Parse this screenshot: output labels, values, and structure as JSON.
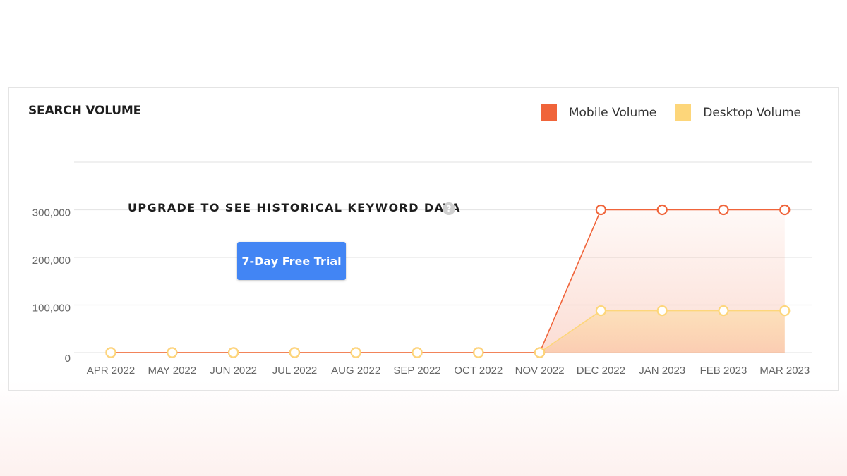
{
  "card": {
    "title": "SEARCH VOLUME"
  },
  "upgrade": {
    "message": "UPGRADE TO SEE HISTORICAL KEYWORD DATA",
    "help_glyph": "?",
    "button_label": "7-Day Free Trial"
  },
  "colors": {
    "mobile": "#f0643a",
    "desktop": "#fdd67a",
    "button": "#4285f4",
    "grid": "#e6e6e6"
  },
  "icons": {
    "help": "question-circle-icon"
  },
  "chart_data": {
    "type": "area",
    "title": "SEARCH VOLUME",
    "categories": [
      "APR 2022",
      "MAY 2022",
      "JUN 2022",
      "JUL 2022",
      "AUG 2022",
      "SEP 2022",
      "OCT 2022",
      "NOV 2022",
      "DEC 2022",
      "JAN 2023",
      "FEB 2023",
      "MAR 2023"
    ],
    "series": [
      {
        "name": "Mobile Volume",
        "color": "#f0643a",
        "values": [
          0,
          0,
          0,
          0,
          0,
          0,
          0,
          0,
          300000,
          300000,
          300000,
          300000
        ]
      },
      {
        "name": "Desktop Volume",
        "color": "#fdd67a",
        "values": [
          0,
          0,
          0,
          0,
          0,
          0,
          0,
          0,
          88000,
          88000,
          88000,
          88000
        ]
      }
    ],
    "y_ticks": [
      "0",
      "100,000",
      "200,000",
      "300,000"
    ],
    "y_tick_values": [
      0,
      100000,
      200000,
      300000
    ],
    "ylim": [
      0,
      400000
    ],
    "grid": true,
    "legend": "top-right"
  }
}
